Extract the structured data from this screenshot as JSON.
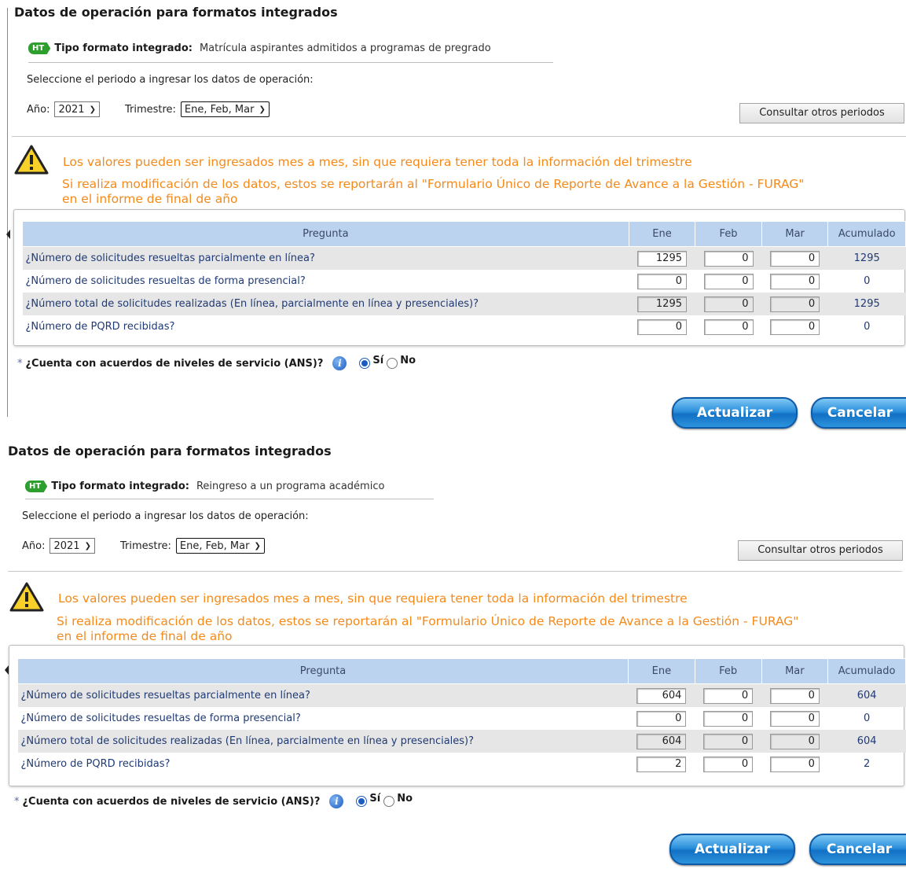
{
  "forms": [
    {
      "heading": "Datos de operación para formatos integrados",
      "ht_badge": "HT",
      "tipo_label": "Tipo formato integrado:",
      "tipo_value": "Matrícula aspirantes admitidos a programas de pregrado",
      "select_period": "Seleccione el periodo a ingresar los datos de operación:",
      "year_label": "Año:",
      "year_value": "2021",
      "quarter_label": "Trimestre:",
      "quarter_value": "Ene, Feb, Mar",
      "consult_button": "Consultar otros periodos",
      "warning_line1": "Los valores pueden ser ingresados mes a mes, sin que requiera tener toda la información del trimestre",
      "warning_line2": "Si realiza modificación de los datos, estos se reportarán al \"Formulario Único de Reporte de Avance a la Gestión - FURAG\"",
      "warning_line3": "en el informe de final de año",
      "headers": [
        "Pregunta",
        "Ene",
        "Feb",
        "Mar",
        "Acumulado"
      ],
      "rows": [
        {
          "q": "¿Número de solicitudes resueltas parcialmente en línea?",
          "ene": "1295",
          "feb": "0",
          "mar": "0",
          "acc": "1295"
        },
        {
          "q": "¿Número de solicitudes resueltas de forma presencial?",
          "ene": "0",
          "feb": "0",
          "mar": "0",
          "acc": "0"
        },
        {
          "q": "¿Número total de solicitudes realizadas (En línea, parcialmente en línea y presenciales)?",
          "ene": "1295",
          "feb": "0",
          "mar": "0",
          "acc": "1295"
        },
        {
          "q": "¿Número de PQRD recibidas?",
          "ene": "0",
          "feb": "0",
          "mar": "0",
          "acc": "0"
        }
      ],
      "ans_star": "*",
      "ans_question": "¿Cuenta con acuerdos de niveles de servicio (ANS)?",
      "info_icon": "i",
      "yes_label": "Sí",
      "no_label": "No",
      "update_button": "Actualizar",
      "cancel_button": "Cancelar"
    },
    {
      "heading": "Datos de operación para formatos integrados",
      "ht_badge": "HT",
      "tipo_label": "Tipo formato integrado:",
      "tipo_value": "Reingreso a un programa académico",
      "select_period": "Seleccione el periodo a ingresar los datos de operación:",
      "year_label": "Año:",
      "year_value": "2021",
      "quarter_label": "Trimestre:",
      "quarter_value": "Ene, Feb, Mar",
      "consult_button": "Consultar otros periodos",
      "warning_line1": "Los valores pueden ser ingresados mes a mes, sin que requiera tener toda la información del trimestre",
      "warning_line2": "Si realiza modificación de los datos, estos se reportarán al \"Formulario Único de Reporte de Avance a la Gestión - FURAG\"",
      "warning_line3": "en el informe de final de año",
      "headers": [
        "Pregunta",
        "Ene",
        "Feb",
        "Mar",
        "Acumulado"
      ],
      "rows": [
        {
          "q": "¿Número de solicitudes resueltas parcialmente en línea?",
          "ene": "604",
          "feb": "0",
          "mar": "0",
          "acc": "604"
        },
        {
          "q": "¿Número de solicitudes resueltas de forma presencial?",
          "ene": "0",
          "feb": "0",
          "mar": "0",
          "acc": "0"
        },
        {
          "q": "¿Número total de solicitudes realizadas (En línea, parcialmente en línea y presenciales)?",
          "ene": "604",
          "feb": "0",
          "mar": "0",
          "acc": "604"
        },
        {
          "q": "¿Número de PQRD recibidas?",
          "ene": "2",
          "feb": "0",
          "mar": "0",
          "acc": "2"
        }
      ],
      "ans_star": "*",
      "ans_question": "¿Cuenta con acuerdos de niveles de servicio (ANS)?",
      "info_icon": "i",
      "yes_label": "Sí",
      "no_label": "No",
      "update_button": "Actualizar",
      "cancel_button": "Cancelar"
    }
  ],
  "colors": {
    "warning_text": "#f48a1a",
    "table_header": "#bcd3f0",
    "question_text": "#1f3a75",
    "button_blue": "#2b8fdb",
    "ht_green": "#2e9e2e"
  },
  "icons": {
    "warning": "warning-triangle-icon",
    "info": "info-icon",
    "ht": "ht-badge-icon"
  }
}
